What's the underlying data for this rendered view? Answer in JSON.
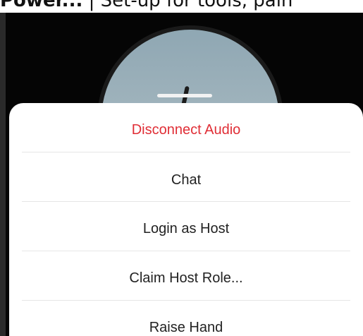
{
  "caption": {
    "bold_part": "Power...",
    "rest_part": "| Set-up for tools, pain"
  },
  "menu": {
    "items": [
      {
        "label": "Disconnect Audio",
        "color": "#e02e36"
      },
      {
        "label": "Chat"
      },
      {
        "label": "Login as Host"
      },
      {
        "label": "Claim Host Role..."
      },
      {
        "label": "Raise Hand"
      }
    ]
  }
}
